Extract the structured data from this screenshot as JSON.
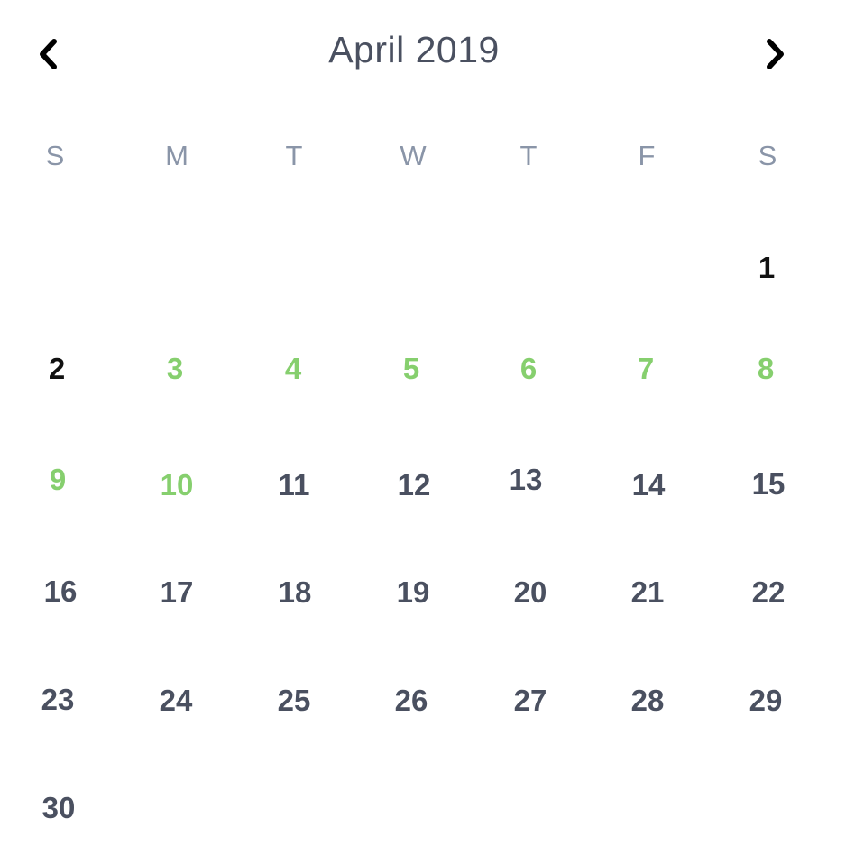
{
  "header": {
    "title": "April 2019",
    "prev_icon": "chevron-left-icon",
    "next_icon": "chevron-right-icon"
  },
  "weekdays": [
    "S",
    "M",
    "T",
    "W",
    "T",
    "F",
    "S"
  ],
  "days": [
    {
      "label": "1",
      "state": "dark"
    },
    {
      "label": "2",
      "state": "dark"
    },
    {
      "label": "3",
      "state": "range"
    },
    {
      "label": "4",
      "state": "range"
    },
    {
      "label": "5",
      "state": "range"
    },
    {
      "label": "6",
      "state": "range"
    },
    {
      "label": "7",
      "state": "range"
    },
    {
      "label": "8",
      "state": "range"
    },
    {
      "label": "9",
      "state": "range"
    },
    {
      "label": "10",
      "state": "range"
    },
    {
      "label": "11",
      "state": "normal"
    },
    {
      "label": "12",
      "state": "normal"
    },
    {
      "label": "13",
      "state": "normal"
    },
    {
      "label": "14",
      "state": "normal"
    },
    {
      "label": "15",
      "state": "normal"
    },
    {
      "label": "16",
      "state": "normal"
    },
    {
      "label": "17",
      "state": "normal"
    },
    {
      "label": "18",
      "state": "normal"
    },
    {
      "label": "19",
      "state": "normal"
    },
    {
      "label": "20",
      "state": "normal"
    },
    {
      "label": "21",
      "state": "normal"
    },
    {
      "label": "22",
      "state": "normal"
    },
    {
      "label": "23",
      "state": "normal"
    },
    {
      "label": "24",
      "state": "normal"
    },
    {
      "label": "25",
      "state": "normal"
    },
    {
      "label": "26",
      "state": "normal"
    },
    {
      "label": "27",
      "state": "normal"
    },
    {
      "label": "28",
      "state": "normal"
    },
    {
      "label": "29",
      "state": "normal"
    },
    {
      "label": "30",
      "state": "normal"
    }
  ],
  "colors": {
    "range": "#86cf6e",
    "normal": "#4a5060",
    "dark": "#111111",
    "weekday": "#8a95a8"
  }
}
